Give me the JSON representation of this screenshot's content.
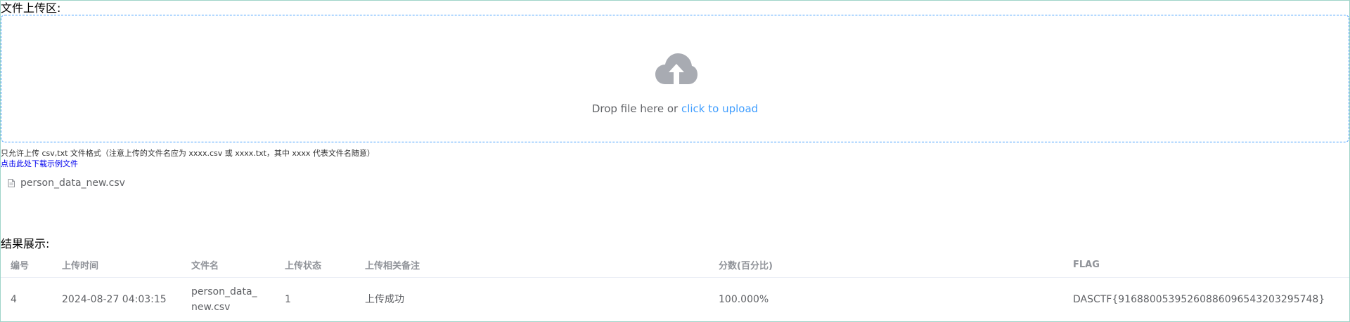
{
  "upload": {
    "title": "文件上传区:",
    "drop_text": "Drop file here or ",
    "click_text": "click to upload",
    "icon": "cloud-upload-icon",
    "tip": "只允许上传 csv,txt 文件格式（注意上传的文件名应为 xxxx.csv 或 xxxx.txt，其中 xxxx 代表文件名随意）",
    "download_link": "点击此处下载示例文件",
    "file_list": [
      {
        "name": "person_data_new.csv",
        "icon": "document-icon"
      }
    ]
  },
  "results": {
    "title": "结果展示:",
    "columns": [
      "编号",
      "上传时间",
      "文件名",
      "上传状态",
      "上传相关备注",
      "分数(百分比)",
      "FLAG"
    ],
    "rows": [
      {
        "id": "4",
        "time": "2024-08-27 04:03:15",
        "filename": "person_data_new.csv",
        "status": "1",
        "note": "上传成功",
        "score": "100.000%",
        "flag": "DASCTF{91688005395260886096543203295748}"
      }
    ]
  },
  "colors": {
    "accent": "#409eff",
    "icon_gray": "#a8abb2",
    "link_blue": "#0000ee"
  }
}
